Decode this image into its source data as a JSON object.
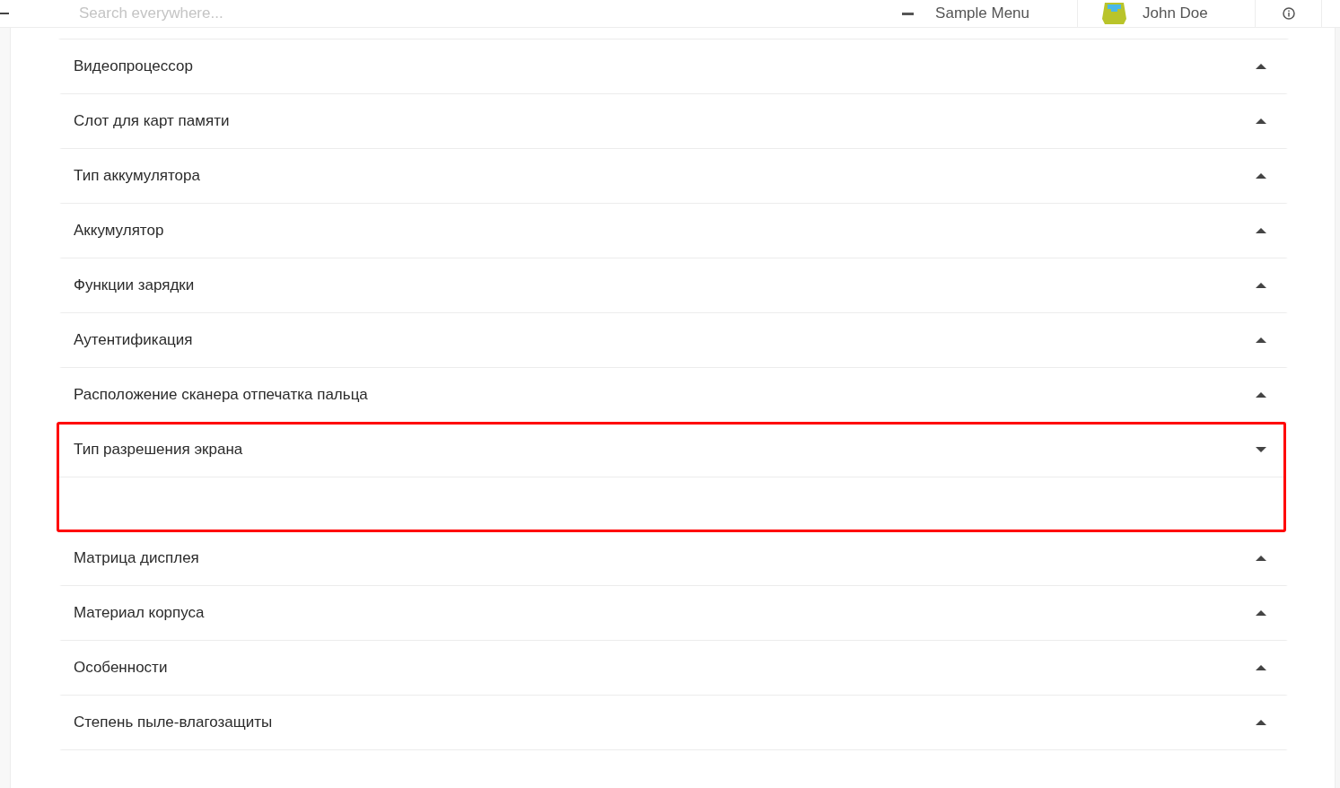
{
  "header": {
    "search": {
      "placeholder": "Search everywhere..."
    },
    "menu": {
      "label": "Sample Menu"
    },
    "user": {
      "name": "John Doe"
    }
  },
  "accordion": {
    "items": [
      {
        "title": "Видеопроцессор",
        "expanded": false,
        "highlighted": false
      },
      {
        "title": "Слот для карт памяти",
        "expanded": false,
        "highlighted": false
      },
      {
        "title": "Тип аккумулятора",
        "expanded": false,
        "highlighted": false
      },
      {
        "title": "Аккумулятор",
        "expanded": false,
        "highlighted": false
      },
      {
        "title": "Функции зарядки",
        "expanded": false,
        "highlighted": false
      },
      {
        "title": "Аутентификация",
        "expanded": false,
        "highlighted": false
      },
      {
        "title": "Расположение сканера отпечатка пальца",
        "expanded": false,
        "highlighted": false
      },
      {
        "title": "Тип разрешения экрана",
        "expanded": true,
        "highlighted": true
      },
      {
        "title": "Матрица дисплея",
        "expanded": false,
        "highlighted": false
      },
      {
        "title": "Материал корпуса",
        "expanded": false,
        "highlighted": false
      },
      {
        "title": "Особенности",
        "expanded": false,
        "highlighted": false
      },
      {
        "title": "Степень пыле-влагозащиты",
        "expanded": false,
        "highlighted": false
      }
    ]
  }
}
